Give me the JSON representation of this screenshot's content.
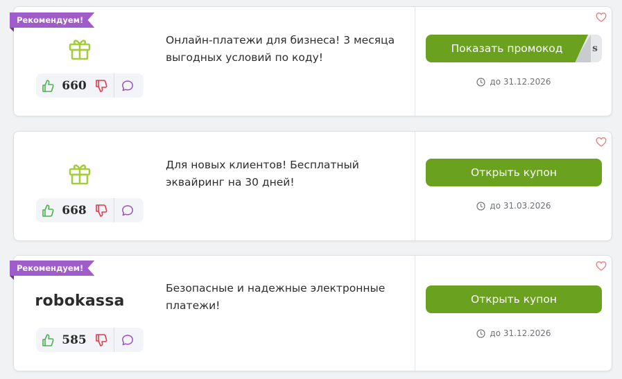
{
  "colors": {
    "accent_green": "#6aa11f",
    "ribbon_purple": "#a05cc9",
    "like_green": "#4caf50",
    "dislike_red": "#e0394a",
    "comment_purple": "#9c4fc0",
    "heart_red": "#e87b7b"
  },
  "cards": [
    {
      "ribbon": "Рекомендуем!",
      "logo": "gift-icon",
      "votes": "660",
      "description": "Онлайн-платежи для бизнеса! 3 месяца выгодных условий по коду!",
      "button": "Показать промокод",
      "promo_tail": "s",
      "expiry": "до 31.12.2026"
    },
    {
      "ribbon": "",
      "logo": "gift-icon",
      "votes": "668",
      "description": "Для новых клиентов! Бесплатный эквайринг на 30 дней!",
      "button": "Открыть купон",
      "expiry": "до 31.03.2026"
    },
    {
      "ribbon": "Рекомендуем!",
      "logo": "robokassa",
      "votes": "585",
      "description": "Безопасные и надежные электронные платежи!",
      "button": "Открыть купон",
      "expiry": "до 31.12.2026"
    }
  ]
}
